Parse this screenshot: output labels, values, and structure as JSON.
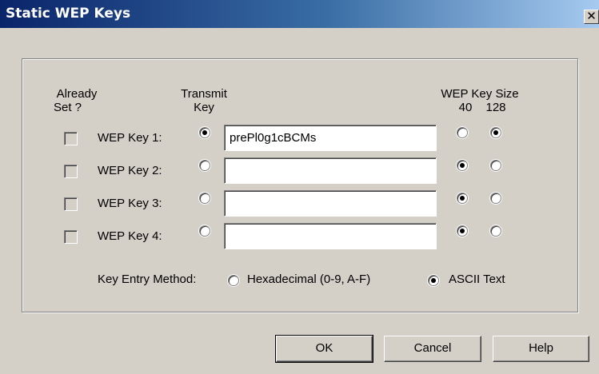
{
  "window": {
    "title": "Static WEP Keys",
    "close_glyph": "✕"
  },
  "headers": {
    "already_set_line1": "Already",
    "already_set_line2": "Set ?",
    "transmit_line1": "Transmit",
    "transmit_line2": "Key",
    "key_size": "WEP Key Size",
    "size_40": "40",
    "size_128": "128"
  },
  "keys": [
    {
      "label": "WEP Key 1:",
      "already_set": false,
      "transmit": true,
      "value": "prePl0g1cBCMs",
      "size": "128"
    },
    {
      "label": "WEP Key 2:",
      "already_set": false,
      "transmit": false,
      "value": "",
      "size": "40"
    },
    {
      "label": "WEP Key 3:",
      "already_set": false,
      "transmit": false,
      "value": "",
      "size": "40"
    },
    {
      "label": "WEP Key 4:",
      "already_set": false,
      "transmit": false,
      "value": "",
      "size": "40"
    }
  ],
  "entry_method": {
    "label": "Key Entry Method:",
    "hex_label": "Hexadecimal (0-9, A-F)",
    "ascii_label": "ASCII Text",
    "selected": "ascii"
  },
  "buttons": {
    "ok": "OK",
    "cancel": "Cancel",
    "help": "Help"
  }
}
